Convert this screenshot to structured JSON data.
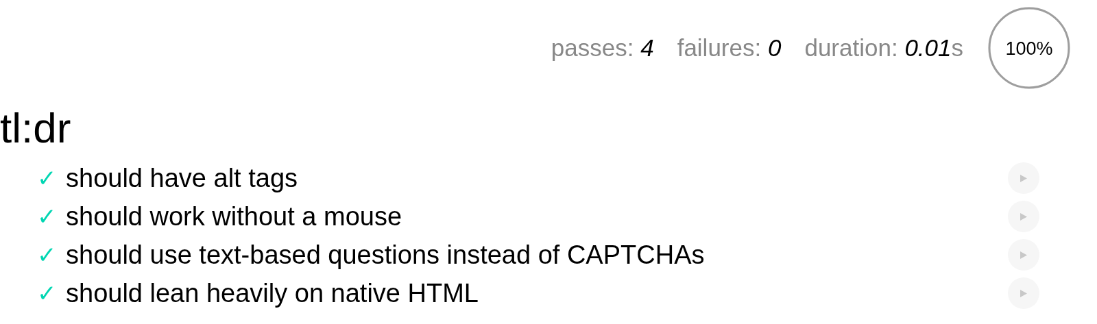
{
  "stats": [
    {
      "label": "passes:",
      "value": "4"
    },
    {
      "label": "failures:",
      "value": "0"
    },
    {
      "label": "duration:",
      "value": "0.01",
      "unit": "s"
    }
  ],
  "progress": {
    "text": "100%",
    "level": 1
  },
  "suite": {
    "title": "tl:dr",
    "tests": [
      {
        "passed": true,
        "mark": "✓",
        "title": "should have alt tags"
      },
      {
        "passed": true,
        "mark": "✓",
        "title": "should work without a mouse"
      },
      {
        "passed": true,
        "mark": "✓",
        "title": "should use text-based questions instead of CAPTCHAs"
      },
      {
        "passed": true,
        "mark": "✓",
        "title": "should lean heavily on native HTML"
      }
    ]
  }
}
